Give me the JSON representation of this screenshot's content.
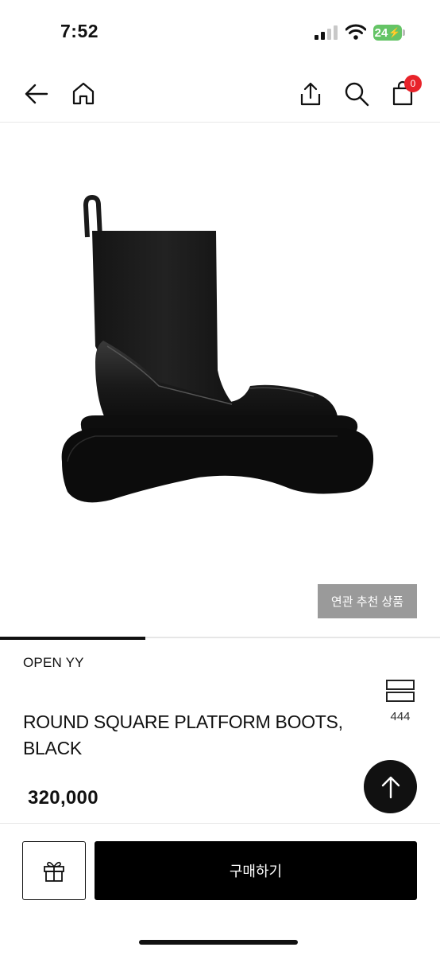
{
  "status_bar": {
    "time": "7:52",
    "battery": "24"
  },
  "header": {
    "cart_count": "0"
  },
  "gallery": {
    "related_label": "연관 추천 상품",
    "progress": 0.33
  },
  "product": {
    "brand": "OPEN YY",
    "name": "ROUND SQUARE PLATFORM BOOTS, BLACK",
    "price": "320,000",
    "compare_count": "444"
  },
  "footer": {
    "buy_label": "구매하기"
  },
  "colors": {
    "accent": "#000000",
    "badge": "#e8232a",
    "related_bg": "#9a9a9a",
    "battery": "#65c466"
  },
  "icons": [
    "back-arrow-icon",
    "home-icon",
    "share-icon",
    "search-icon",
    "cart-icon",
    "compare-icon",
    "arrow-up-icon",
    "gift-icon"
  ]
}
